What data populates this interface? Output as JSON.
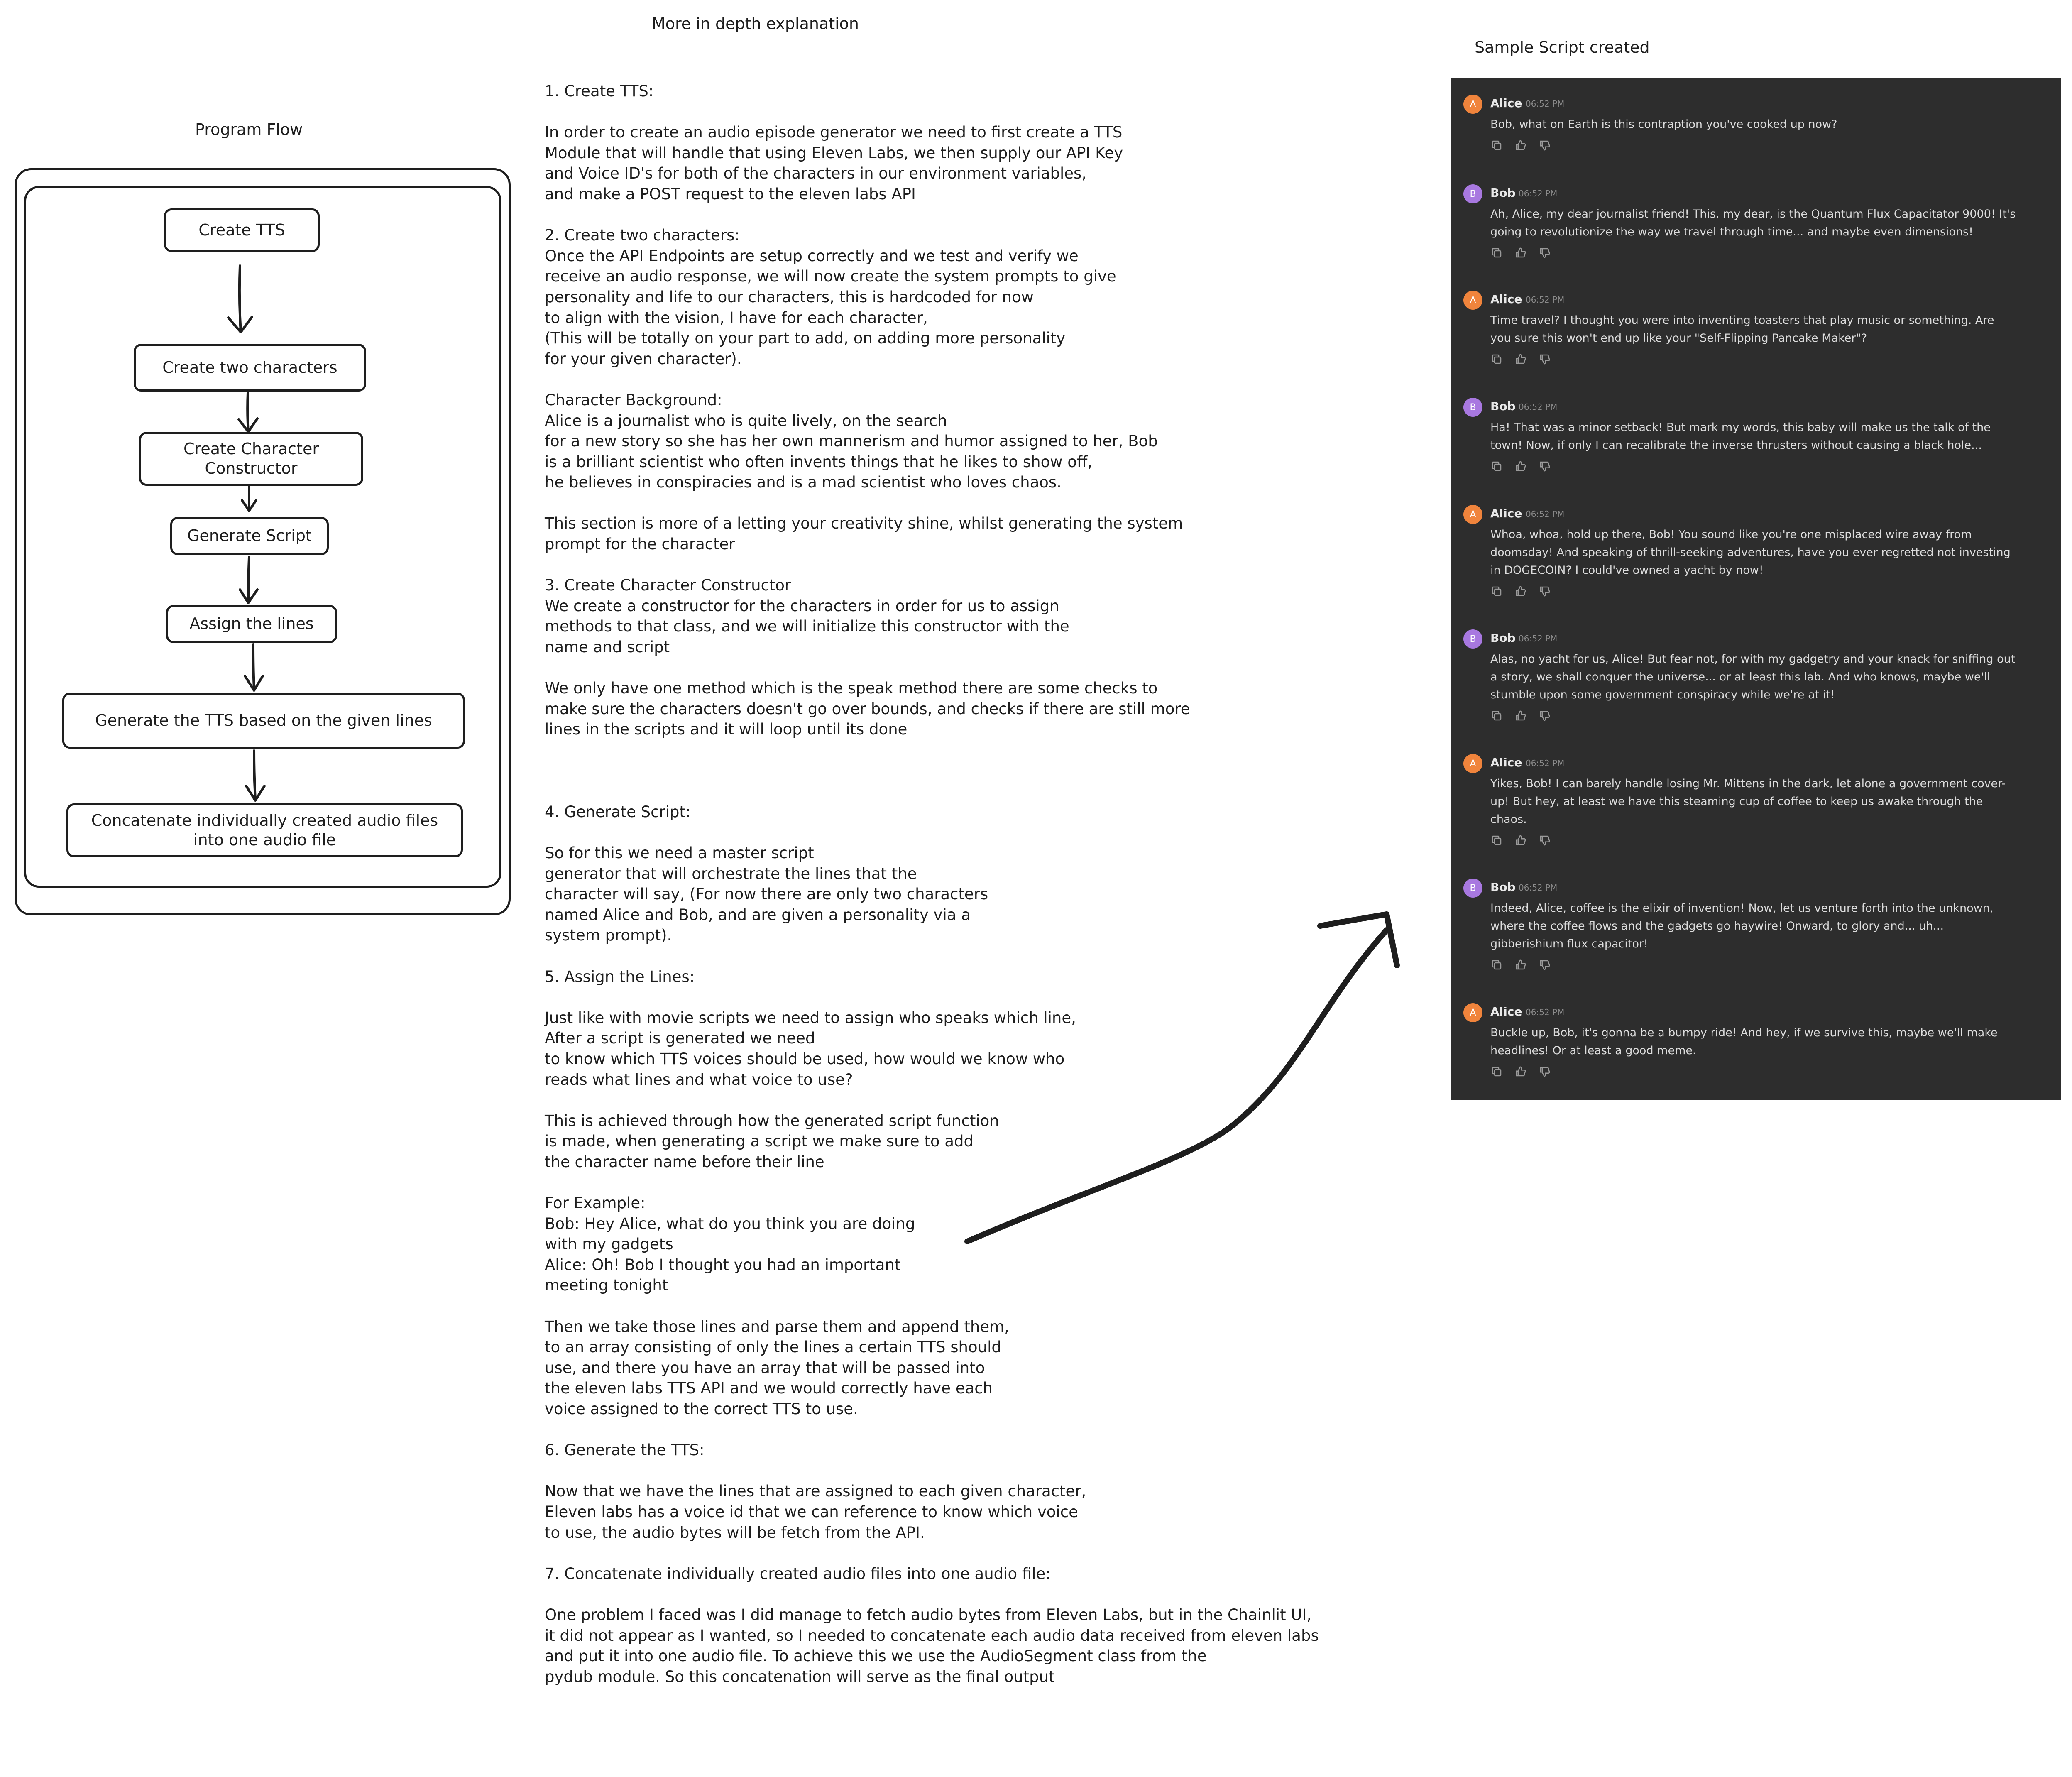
{
  "flow": {
    "title": "Program Flow",
    "nodes": [
      "Create TTS",
      "Create two characters",
      "Create Character Constructor",
      "Generate Script",
      "Assign the lines",
      "Generate the TTS based on the given lines",
      "Concatenate individually created audio files into one audio file"
    ]
  },
  "explanation": {
    "title": "More in depth explanation",
    "paragraphs": [
      "1. Create TTS:",
      "In order to create an audio episode generator we need to first create a TTS\nModule that will handle that using Eleven Labs, we then supply our API Key\nand Voice ID's for both of the characters in our environment variables,\nand make a POST request to the eleven labs API",
      "2. Create two characters:\nOnce the API Endpoints are setup correctly and we test and verify we\nreceive an audio response, we will now create the system prompts to give\npersonality and life to our characters, this is hardcoded for now\nto align with the vision, I have for each character,\n(This will be totally on your part to add, on adding more personality\nfor your given character).",
      "Character Background:\nAlice is a journalist who is quite lively, on the search\nfor a new story so she has her own mannerism and humor assigned to her, Bob\nis a brilliant scientist who often invents things that he likes to show off,\nhe believes in conspiracies and is a mad scientist who loves chaos.",
      "This section is more of a letting your creativity shine, whilst generating the system\nprompt for the character",
      "3. Create Character Constructor\nWe create a constructor for the characters in order for us to assign\nmethods to that class, and we will initialize this constructor with the\nname and script",
      "We only have one method which is the speak method there are some checks to\nmake sure the characters doesn't go over bounds, and checks if there are still more\nlines in the scripts and it will loop until its done",
      "",
      "4. Generate Script:",
      "So for this we need a master script\ngenerator that will orchestrate the lines that the\ncharacter will say, (For now there are only two characters\nnamed Alice and Bob, and are given a personality via a\nsystem prompt).",
      "5. Assign the Lines:",
      "Just like with movie scripts we need to assign who speaks which line,\nAfter a script is generated we need\nto know which TTS voices should be used, how would we know who\nreads what lines and what voice to use?",
      "This is achieved through how the generated script function\nis made, when generating a script we make sure to add\nthe character name before their line",
      "For Example:\nBob: Hey Alice, what do you think you are doing\nwith my gadgets\nAlice: Oh! Bob I thought you had an important\nmeeting tonight",
      "Then we take those lines and parse them and append them,\nto an array consisting of only the lines a certain TTS should\nuse, and there you have an array that will be passed into\nthe eleven labs TTS API and we would correctly have each\nvoice assigned to the correct TTS to use.",
      "6. Generate the TTS:",
      "Now that we have the lines that are assigned to each given character,\nEleven labs has a voice id that we can reference to know which voice\nto use, the audio bytes will be fetch from the API.",
      "7. Concatenate individually created audio files into one audio file:",
      "One problem I faced was I did manage to fetch audio bytes from Eleven Labs, but in the Chainlit UI,\nit did not appear as I wanted, so I needed to concatenate each audio data received from eleven labs\nand put it into one audio file. To achieve this we use the AudioSegment class from the\npydub module. So this concatenation will serve as the final output"
    ]
  },
  "chat": {
    "title": "Sample Script created",
    "colors": {
      "alice": "#f0843c",
      "bob": "#a878e0",
      "background": "#2d2d2d"
    },
    "messages": [
      {
        "author": "Alice",
        "initial": "A",
        "time": "06:52 PM",
        "text": "Bob, what on Earth is this contraption you've cooked up now?"
      },
      {
        "author": "Bob",
        "initial": "B",
        "time": "06:52 PM",
        "text": "Ah, Alice, my dear journalist friend! This, my dear, is the Quantum Flux Capacitator 9000! It's going to revolutionize the way we travel through time... and maybe even dimensions!"
      },
      {
        "author": "Alice",
        "initial": "A",
        "time": "06:52 PM",
        "text": "Time travel? I thought you were into inventing toasters that play music or something. Are you sure this won't end up like your \"Self-Flipping Pancake Maker\"?"
      },
      {
        "author": "Bob",
        "initial": "B",
        "time": "06:52 PM",
        "text": "Ha! That was a minor setback! But mark my words, this baby will make us the talk of the town! Now, if only I can recalibrate the inverse thrusters without causing a black hole..."
      },
      {
        "author": "Alice",
        "initial": "A",
        "time": "06:52 PM",
        "text": "Whoa, whoa, hold up there, Bob! You sound like you're one misplaced wire away from doomsday! And speaking of thrill-seeking adventures, have you ever regretted not investing in DOGECOIN? I could've owned a yacht by now!"
      },
      {
        "author": "Bob",
        "initial": "B",
        "time": "06:52 PM",
        "text": "Alas, no yacht for us, Alice! But fear not, for with my gadgetry and your knack for sniffing out a story, we shall conquer the universe... or at least this lab. And who knows, maybe we'll stumble upon some government conspiracy while we're at it!"
      },
      {
        "author": "Alice",
        "initial": "A",
        "time": "06:52 PM",
        "text": "Yikes, Bob! I can barely handle losing Mr. Mittens in the dark, let alone a government cover-up! But hey, at least we have this steaming cup of coffee to keep us awake through the chaos."
      },
      {
        "author": "Bob",
        "initial": "B",
        "time": "06:52 PM",
        "text": "Indeed, Alice, coffee is the elixir of invention! Now, let us venture forth into the unknown, where the coffee flows and the gadgets go haywire! Onward, to glory and... uh... gibberishium flux capacitor!"
      },
      {
        "author": "Alice",
        "initial": "A",
        "time": "06:52 PM",
        "text": "Buckle up, Bob, it's gonna be a bumpy ride! And hey, if we survive this, maybe we'll make headlines! Or at least a good meme."
      }
    ]
  }
}
